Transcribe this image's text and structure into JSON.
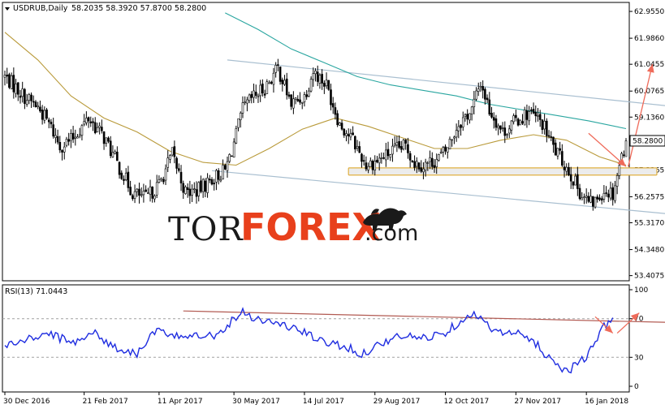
{
  "chart_data": {
    "type": "candlestick",
    "header": {
      "symbol_label": "USDRUB,Daily",
      "ohlc": "58.2035 58.3920 57.8700 58.2800"
    },
    "price_axis": {
      "ylim": [
        53.25,
        63.25
      ],
      "ticks": [
        "62.9550",
        "61.9860",
        "61.0455",
        "60.0765",
        "59.1360",
        "58.1955",
        "57.2265",
        "56.2575",
        "55.3170",
        "54.3480",
        "53.4075"
      ],
      "tick_values": [
        62.955,
        61.986,
        61.0455,
        60.0765,
        59.136,
        58.1955,
        57.2265,
        56.2575,
        55.317,
        54.348,
        53.4075
      ],
      "current_price": "58.2800"
    },
    "time_axis": {
      "labels": [
        "30 Dec 2016",
        "21 Feb 2017",
        "11 Apr 2017",
        "30 May 2017",
        "14 Jul 2017",
        "29 Aug 2017",
        "12 Oct 2017",
        "27 Nov 2017",
        "16 Jan 2018"
      ],
      "label_bar_index": [
        0,
        36,
        70,
        104,
        136,
        168,
        200,
        232,
        264
      ]
    },
    "bar_count": 283,
    "price_path": [
      [
        0,
        60.6
      ],
      [
        5,
        60.2
      ],
      [
        10,
        59.8
      ],
      [
        15,
        59.5
      ],
      [
        20,
        58.9
      ],
      [
        25,
        58.1
      ],
      [
        30,
        58.3
      ],
      [
        38,
        59.1
      ],
      [
        45,
        58.4
      ],
      [
        52,
        57.3
      ],
      [
        58,
        56.4
      ],
      [
        64,
        56.2
      ],
      [
        70,
        56.7
      ],
      [
        76,
        57.8
      ],
      [
        82,
        56.4
      ],
      [
        88,
        56.5
      ],
      [
        94,
        56.9
      ],
      [
        100,
        57.2
      ],
      [
        104,
        58.2
      ],
      [
        108,
        59.4
      ],
      [
        112,
        59.8
      ],
      [
        118,
        60.2
      ],
      [
        124,
        60.9
      ],
      [
        130,
        59.6
      ],
      [
        136,
        59.9
      ],
      [
        140,
        60.8
      ],
      [
        146,
        60.3
      ],
      [
        152,
        58.9
      ],
      [
        158,
        58.3
      ],
      [
        164,
        57.4
      ],
      [
        170,
        57.6
      ],
      [
        176,
        57.9
      ],
      [
        182,
        58.1
      ],
      [
        186,
        57.5
      ],
      [
        190,
        57.4
      ],
      [
        196,
        57.6
      ],
      [
        200,
        57.9
      ],
      [
        206,
        58.9
      ],
      [
        212,
        59.4
      ],
      [
        216,
        60.4
      ],
      [
        220,
        59.4
      ],
      [
        226,
        58.6
      ],
      [
        232,
        59.0
      ],
      [
        238,
        59.3
      ],
      [
        244,
        58.9
      ],
      [
        250,
        57.9
      ],
      [
        256,
        57.2
      ],
      [
        262,
        56.3
      ],
      [
        266,
        56.0
      ],
      [
        268,
        56.1
      ],
      [
        272,
        56.5
      ],
      [
        276,
        56.4
      ],
      [
        279,
        57.4
      ],
      [
        282,
        58.28
      ]
    ],
    "moving_averages": [
      {
        "color": "#b99a3a",
        "points": [
          [
            0,
            62.2
          ],
          [
            15,
            61.2
          ],
          [
            30,
            59.9
          ],
          [
            45,
            59.1
          ],
          [
            60,
            58.6
          ],
          [
            75,
            57.9
          ],
          [
            90,
            57.5
          ],
          [
            105,
            57.4
          ],
          [
            120,
            58.0
          ],
          [
            135,
            58.7
          ],
          [
            150,
            59.1
          ],
          [
            165,
            58.8
          ],
          [
            180,
            58.4
          ],
          [
            195,
            58.0
          ],
          [
            210,
            58.0
          ],
          [
            225,
            58.3
          ],
          [
            240,
            58.5
          ],
          [
            255,
            58.3
          ],
          [
            270,
            57.7
          ],
          [
            282,
            57.4
          ]
        ]
      },
      {
        "color": "#2aa6a0",
        "points": [
          [
            100,
            62.9
          ],
          [
            115,
            62.3
          ],
          [
            130,
            61.6
          ],
          [
            145,
            61.1
          ],
          [
            160,
            60.6
          ],
          [
            175,
            60.3
          ],
          [
            190,
            60.1
          ],
          [
            205,
            59.9
          ],
          [
            220,
            59.6
          ],
          [
            235,
            59.4
          ],
          [
            250,
            59.2
          ],
          [
            265,
            59.0
          ],
          [
            282,
            58.72
          ]
        ]
      }
    ],
    "channel_lines": [
      {
        "from": [
          101,
          61.2
        ],
        "to": [
          318,
          59.4
        ]
      },
      {
        "from": [
          94,
          57.2
        ],
        "to": [
          333,
          55.4
        ]
      }
    ],
    "support_zone": {
      "from_x": 156,
      "to_x": 296,
      "y_low": 57.04,
      "y_high": 57.3
    },
    "forecast_arrows": [
      {
        "from": [
          265,
          58.55
        ],
        "to": [
          282,
          57.35
        ]
      },
      {
        "from": [
          283,
          57.35
        ],
        "to": [
          294,
          61.05
        ]
      }
    ],
    "watermark": {
      "tor": "TOR",
      "forex": "FOREX",
      "com": ".com"
    },
    "rsi": {
      "label": "RSI(13) 71.0443",
      "ylim": [
        0,
        100
      ],
      "ticks": [
        "100",
        "70",
        "30",
        "0"
      ],
      "tick_values": [
        100,
        70,
        30,
        0
      ],
      "levels": [
        70,
        30
      ],
      "path": [
        [
          0,
          42
        ],
        [
          10,
          48
        ],
        [
          20,
          55
        ],
        [
          30,
          45
        ],
        [
          40,
          56
        ],
        [
          50,
          40
        ],
        [
          60,
          34
        ],
        [
          66,
          52
        ],
        [
          70,
          58
        ],
        [
          76,
          50
        ],
        [
          86,
          55
        ],
        [
          96,
          52
        ],
        [
          104,
          70
        ],
        [
          108,
          78
        ],
        [
          114,
          70
        ],
        [
          124,
          65
        ],
        [
          134,
          58
        ],
        [
          144,
          46
        ],
        [
          154,
          42
        ],
        [
          162,
          33
        ],
        [
          170,
          44
        ],
        [
          180,
          52
        ],
        [
          190,
          50
        ],
        [
          200,
          56
        ],
        [
          208,
          70
        ],
        [
          212,
          76
        ],
        [
          218,
          65
        ],
        [
          226,
          54
        ],
        [
          232,
          55
        ],
        [
          240,
          47
        ],
        [
          246,
          32
        ],
        [
          252,
          20
        ],
        [
          256,
          16
        ],
        [
          260,
          26
        ],
        [
          264,
          28
        ],
        [
          268,
          46
        ],
        [
          272,
          62
        ],
        [
          276,
          71
        ]
      ],
      "trendline": {
        "from": [
          81,
          78
        ],
        "to": [
          323,
          65
        ]
      },
      "forecast_arrows": [
        {
          "from": [
            268,
            72
          ],
          "to": [
            276,
            55
          ]
        },
        {
          "from": [
            278,
            55
          ],
          "to": [
            288,
            76
          ]
        }
      ]
    }
  }
}
